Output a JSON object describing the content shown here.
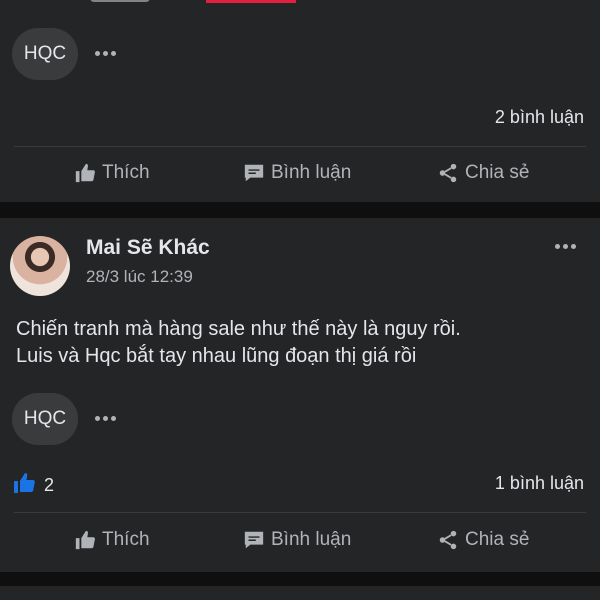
{
  "posts": [
    {
      "reaction_chip": "HQC",
      "comment_count": "2 bình luận",
      "actions": {
        "like": "Thích",
        "comment": "Bình luận",
        "share": "Chia sẻ"
      }
    },
    {
      "author": "Mai Sẽ Khác",
      "time": "28/3 lúc 12:39",
      "text_line1": "Chiến tranh mà hàng sale như thế này là nguy rồi.",
      "text_line2": "Luis và Hqc bắt tay nhau lũng đoạn thị giá rồi",
      "reaction_chip": "HQC",
      "like_count": "2",
      "comment_count": "1 bình luận",
      "actions": {
        "like": "Thích",
        "comment": "Bình luận",
        "share": "Chia sẻ"
      }
    }
  ],
  "colors": {
    "card_bg": "#242526",
    "page_bg": "#0f0f0f",
    "like_blue": "#1b74e4",
    "accent_red": "#e41e3f"
  },
  "icons": [
    "thumbs-up-icon",
    "comment-icon",
    "share-icon",
    "more-dots-icon"
  ]
}
